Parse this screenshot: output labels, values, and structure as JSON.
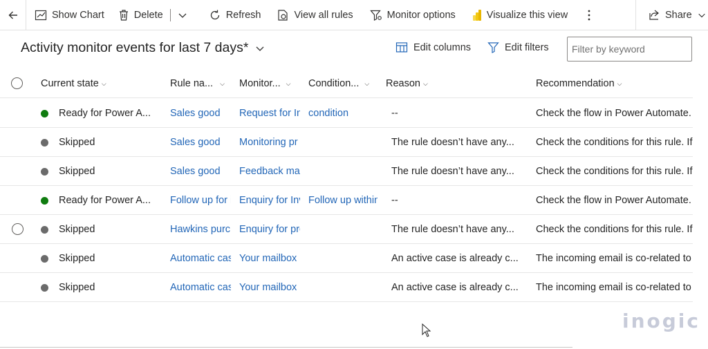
{
  "toolbar": {
    "show_chart": "Show Chart",
    "delete": "Delete",
    "refresh": "Refresh",
    "view_all_rules": "View all rules",
    "monitor_options": "Monitor options",
    "visualize": "Visualize this view",
    "share": "Share"
  },
  "view": {
    "title": "Activity monitor events for last 7 days*",
    "edit_columns": "Edit columns",
    "edit_filters": "Edit filters",
    "filter_placeholder": "Filter by keyword"
  },
  "columns": {
    "current_state": "Current state",
    "rule_name": "Rule na...",
    "monitor": "Monitor...",
    "condition": "Condition...",
    "reason": "Reason",
    "recommendation": "Recommendation"
  },
  "rows": [
    {
      "state": "Ready for Power A...",
      "state_color": "#107c10",
      "rule": "Sales good",
      "monitor": "Request for In",
      "condition": "condition",
      "reason": "--",
      "recommendation": "Check the flow in Power Automate."
    },
    {
      "state": "Skipped",
      "state_color": "#6b6b6b",
      "rule": "Sales good",
      "monitor": "Monitoring pr",
      "condition": "",
      "reason": "The rule doesn’t have any...",
      "recommendation": "Check the conditions for this rule. If t"
    },
    {
      "state": "Skipped",
      "state_color": "#6b6b6b",
      "rule": "Sales good",
      "monitor": "Feedback mail",
      "condition": "",
      "reason": "The rule doesn’t have any...",
      "recommendation": "Check the conditions for this rule. If t"
    },
    {
      "state": "Ready for Power A...",
      "state_color": "#107c10",
      "rule": "Follow up for i",
      "monitor": "Enquiry for Inv",
      "condition": "Follow up within",
      "reason": "--",
      "recommendation": "Check the flow in Power Automate."
    },
    {
      "state": "Skipped",
      "state_color": "#6b6b6b",
      "rule": "Hawkins purch",
      "monitor": "Enquiry for pro",
      "condition": "",
      "reason": "The rule doesn’t have any...",
      "recommendation": "Check the conditions for this rule. If t"
    },
    {
      "state": "Skipped",
      "state_color": "#6b6b6b",
      "rule": "Automatic cas",
      "monitor": "Your mailbox i",
      "condition": "",
      "reason": "An active case is already c...",
      "recommendation": "The incoming email is co-related to t"
    },
    {
      "state": "Skipped",
      "state_color": "#6b6b6b",
      "rule": "Automatic cas",
      "monitor": "Your mailbox i",
      "condition": "",
      "reason": "An active case is already c...",
      "recommendation": "The incoming email is co-related to t"
    }
  ],
  "watermark": "inogic",
  "colors": {
    "link": "#2266b7",
    "ready": "#107c10",
    "skipped": "#6b6b6b"
  }
}
